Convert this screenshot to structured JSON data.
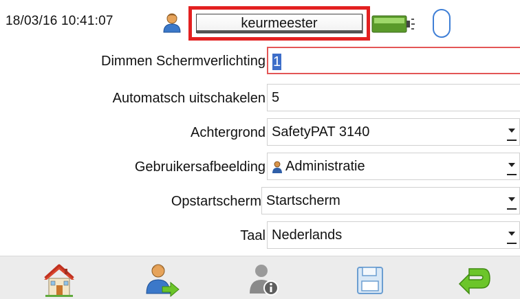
{
  "status": {
    "datetime": "18/03/16 10:41:07",
    "user": "keurmeester"
  },
  "form": {
    "rows": [
      {
        "label": "Dimmen Schermverlichting",
        "value": "1",
        "type": "input",
        "focused": true
      },
      {
        "label": "Automatsch uitschakelen",
        "value": "5",
        "type": "input"
      },
      {
        "label": "Achtergrond",
        "value": "SafetyPAT 3140",
        "type": "select"
      },
      {
        "label": "Gebruikersafbeelding",
        "value": "Administratie",
        "type": "select",
        "icon": "user-figure-icon"
      },
      {
        "label": "Opstartscherm",
        "value": "Startscherm",
        "type": "select"
      },
      {
        "label": "Taal",
        "value": "Nederlands",
        "type": "select"
      }
    ]
  },
  "toolbar": {
    "buttons": [
      "home-icon",
      "switch-user-icon",
      "user-info-icon",
      "save-icon",
      "back-arrow-icon"
    ]
  },
  "colors": {
    "highlight_border": "#e32020",
    "selection": "#3d6ec9",
    "battery_fill": "#7bbf3a",
    "back_arrow": "#6cc52a"
  }
}
